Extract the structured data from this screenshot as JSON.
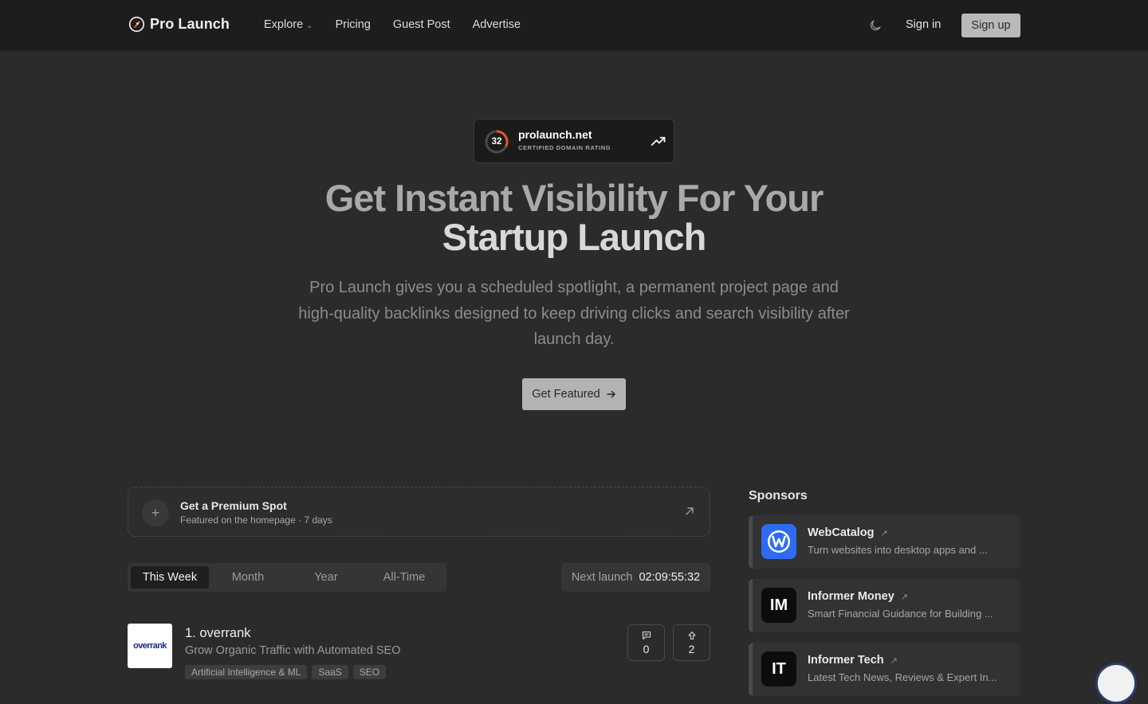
{
  "header": {
    "brand": "Pro Launch",
    "nav": [
      {
        "label": "Explore",
        "has_dropdown": true
      },
      {
        "label": "Pricing"
      },
      {
        "label": "Guest Post"
      },
      {
        "label": "Advertise"
      }
    ],
    "sign_in": "Sign in",
    "sign_up": "Sign up"
  },
  "domain_badge": {
    "rating": "32",
    "domain": "prolaunch.net",
    "caption": "CERTIFIED DOMAIN RATING"
  },
  "hero": {
    "title_line1": "Get Instant Visibility For Your",
    "title_line2": "Startup Launch",
    "description": "Pro Launch gives you a scheduled spotlight, a permanent project page and high-quality backlinks designed to keep driving clicks and search visibility after launch day.",
    "cta": "Get Featured"
  },
  "premium_spot": {
    "title": "Get a Premium Spot",
    "subtitle": "Featured on the homepage · 7 days"
  },
  "tabs": [
    "This Week",
    "Month",
    "Year",
    "All-Time"
  ],
  "active_tab": "This Week",
  "countdown": {
    "label": "Next launch",
    "value": "02:09:55:32"
  },
  "products": [
    {
      "rank_name": "1. overrank",
      "logo_text": "overrank",
      "tagline": "Grow Organic Traffic with Automated SEO",
      "categories": [
        "Artificial Intelligence & ML",
        "SaaS",
        "SEO"
      ],
      "comments": "0",
      "upvotes": "2"
    }
  ],
  "sponsors": {
    "title": "Sponsors",
    "items": [
      {
        "name": "WebCatalog",
        "desc": "Turn websites into desktop apps and ...",
        "logo": "W",
        "color": "#2f6bf2"
      },
      {
        "name": "Informer Money",
        "desc": "Smart Financial Guidance for Building ...",
        "logo": "IM",
        "color": "#0c0c0c"
      },
      {
        "name": "Informer Tech",
        "desc": "Latest Tech News, Reviews & Expert In...",
        "logo": "IT",
        "color": "#0c0c0c"
      }
    ]
  }
}
